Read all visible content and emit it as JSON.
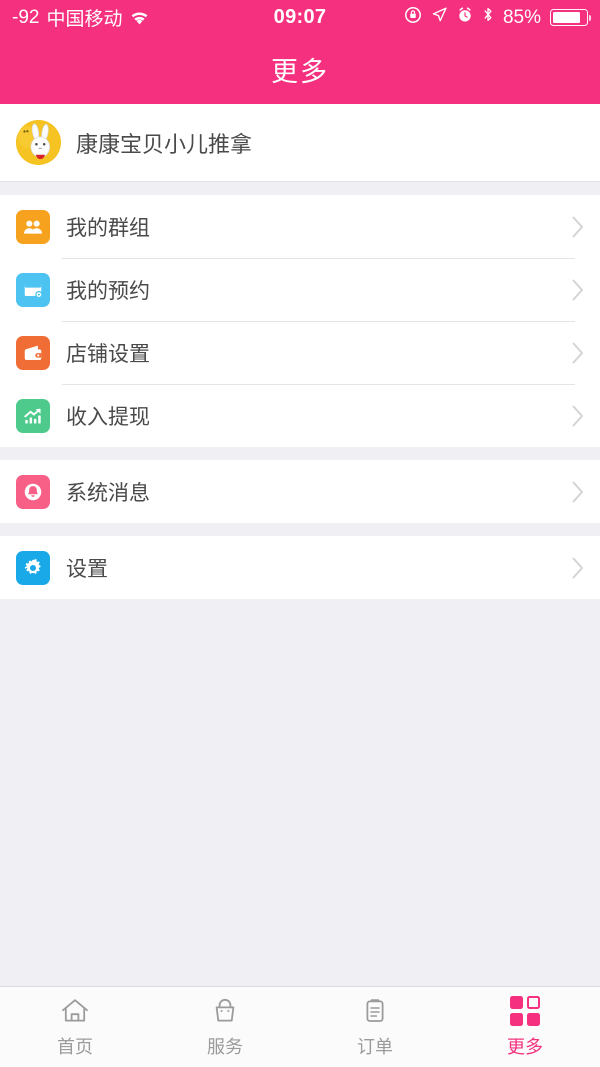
{
  "status_bar": {
    "signal_text": "-92",
    "carrier": "中国移动",
    "wifi_icon": "wifi-icon",
    "time": "09:07",
    "rotation_lock_icon": "rotation-lock-icon",
    "location_icon": "location-arrow-icon",
    "alarm_icon": "alarm-clock-icon",
    "bluetooth_icon": "bluetooth-icon",
    "battery_percent": "85%",
    "battery_level": 85
  },
  "nav_bar": {
    "title": "更多",
    "background": "#f5317f",
    "text_color": "#ffffff"
  },
  "profile": {
    "name": "康康宝贝小儿推拿",
    "avatar_icon": "rabbit-avatar",
    "avatar_bg": "#f5c423"
  },
  "groups": [
    {
      "items": [
        {
          "label": "我的群组",
          "icon": "group-people-icon",
          "icon_class": "ico-group",
          "icon_bg": "#f6a21e",
          "chevron": "chevron-right-icon"
        },
        {
          "label": "我的预约",
          "icon": "appointment-card-icon",
          "icon_class": "ico-booking",
          "icon_bg": "#4cc3f0",
          "chevron": "chevron-right-icon"
        },
        {
          "label": "店铺设置",
          "icon": "wallet-icon",
          "icon_class": "ico-shop",
          "icon_bg": "#f06d35",
          "chevron": "chevron-right-icon"
        },
        {
          "label": "收入提现",
          "icon": "chart-growth-icon",
          "icon_class": "ico-income",
          "icon_bg": "#4ecb8c",
          "chevron": "chevron-right-icon"
        }
      ]
    },
    {
      "items": [
        {
          "label": "系统消息",
          "icon": "bell-icon",
          "icon_class": "ico-message",
          "icon_bg": "#f75f86",
          "chevron": "chevron-right-icon"
        }
      ]
    },
    {
      "items": [
        {
          "label": "设置",
          "icon": "gear-icon",
          "icon_class": "ico-settings",
          "icon_bg": "#19a8e8",
          "chevron": "chevron-right-icon"
        }
      ]
    }
  ],
  "tab_bar": {
    "active_color": "#f5317f",
    "inactive_color": "#9b9b9b",
    "tabs": [
      {
        "label": "首页",
        "icon": "home-icon",
        "active": false
      },
      {
        "label": "服务",
        "icon": "bag-icon",
        "active": false
      },
      {
        "label": "订单",
        "icon": "clipboard-icon",
        "active": false
      },
      {
        "label": "更多",
        "icon": "grid-icon",
        "active": true
      }
    ]
  }
}
